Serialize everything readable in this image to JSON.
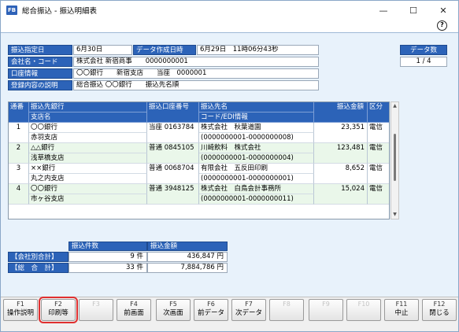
{
  "window": {
    "app_icon": "FB",
    "title": "総合振込 - 振込明細表",
    "minimize": "—",
    "maximize": "☐",
    "close": "✕",
    "help": "?"
  },
  "header": {
    "transfer_date_label": "振込指定日",
    "transfer_date": "6月30日",
    "created_label": "データ作成日時",
    "created_value": "6月29日　11時06分43秒",
    "company_label": "会社名・コード",
    "company_value": "株式会社 新宿商事　　0000000001",
    "account_label": "口座情報",
    "account_value": "〇〇銀行　　新宿支店　　当座　0000001",
    "desc_label": "登録内容の説明",
    "desc_value": "総合振込 〇〇銀行　　振込先名順",
    "data_count_label": "データ数",
    "data_count_value": "1 /  4"
  },
  "grid": {
    "columns": {
      "no": "通番",
      "bank": "振込先銀行",
      "branch": "支店名",
      "account": "振込口座番号",
      "payee": "振込先名",
      "code": "コード/EDI情報",
      "amount": "振込金額",
      "type": "区分"
    },
    "rows": [
      {
        "no": "1",
        "bank": "〇〇銀行",
        "branch": "赤羽支店",
        "account": "当座 0163784",
        "payee": "株式会社　秋葉道園",
        "code": "(0000000001-0000000008)",
        "amount": "23,351",
        "type": "電信"
      },
      {
        "no": "2",
        "bank": "△△銀行",
        "branch": "浅草橋支店",
        "account": "普通 0845105",
        "payee": "川崎飲料　株式会社",
        "code": "(0000000001-0000000004)",
        "amount": "123,481",
        "type": "電信"
      },
      {
        "no": "3",
        "bank": "××銀行",
        "branch": "丸之内支店",
        "account": "普通 0068704",
        "payee": "有限会社　五反田印刷",
        "code": "(0000000001-0000000001)",
        "amount": "8,652",
        "type": "電信"
      },
      {
        "no": "4",
        "bank": "〇〇銀行",
        "branch": "市ヶ谷支店",
        "account": "普通 3948125",
        "payee": "株式会社　白鳥会計事務所",
        "code": "(0000000001-0000000011)",
        "amount": "15,024",
        "type": "電信"
      }
    ]
  },
  "summary": {
    "count_header": "振込件数",
    "amount_header": "振込金額",
    "company_total_label": "【会社別合計】",
    "company_total_count": "9 件",
    "company_total_amount": "436,847 円",
    "grand_total_label": "【総　合　計】",
    "grand_total_count": "33 件",
    "grand_total_amount": "7,884,786 円"
  },
  "fkeys": [
    {
      "num": "F1",
      "label": "操作説明"
    },
    {
      "num": "F2",
      "label": "印刷等"
    },
    {
      "num": "F3",
      "label": ""
    },
    {
      "num": "F4",
      "label": "前画面"
    },
    {
      "num": "F5",
      "label": "次画面"
    },
    {
      "num": "F6",
      "label": "前データ"
    },
    {
      "num": "F7",
      "label": "次データ"
    },
    {
      "num": "F8",
      "label": ""
    },
    {
      "num": "F9",
      "label": ""
    },
    {
      "num": "F10",
      "label": ""
    },
    {
      "num": "F11",
      "label": "中止"
    },
    {
      "num": "F12",
      "label": "閉じる"
    }
  ],
  "colors": {
    "header_blue": "#2c63b8",
    "row_green": "#eaf7ea",
    "background": "#e8f2fb",
    "highlight": "#e03030"
  }
}
